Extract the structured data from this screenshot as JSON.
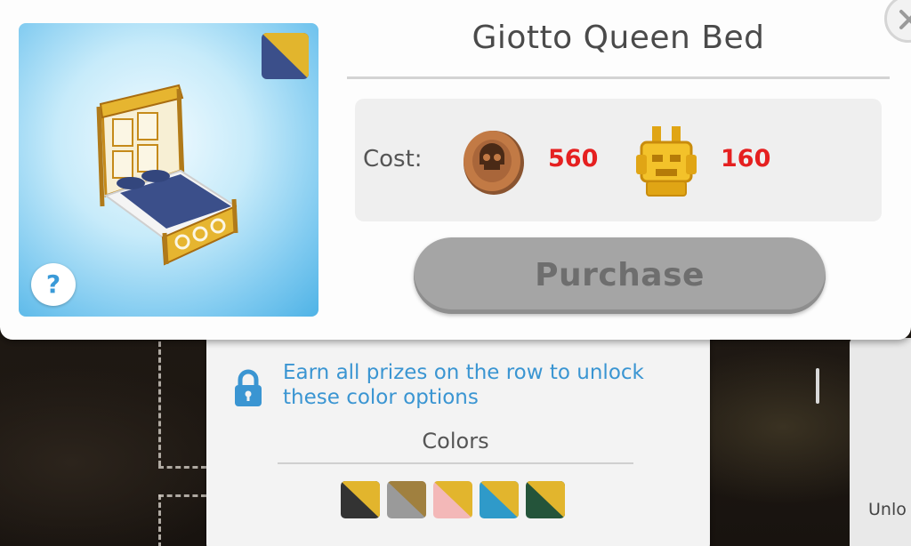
{
  "item": {
    "title": "Giotto Queen Bed"
  },
  "cost": {
    "label": "Cost:",
    "currencies": [
      {
        "icon": "skull-coin-icon",
        "amount": "560"
      },
      {
        "icon": "gold-mask-icon",
        "amount": "160"
      }
    ]
  },
  "purchase": {
    "label": "Purchase",
    "enabled": false
  },
  "help": {
    "label": "?"
  },
  "colors_panel": {
    "unlock_message": "Earn all prizes on the row to unlock these color options",
    "title": "Colors",
    "swatches": [
      {
        "name": "black-gold",
        "primary": "#333333",
        "secondary": "#e2b52d"
      },
      {
        "name": "gray-gold",
        "primary": "#9a9a9a",
        "secondary": "#a0803f"
      },
      {
        "name": "pink-gold",
        "primary": "#f3b8b8",
        "secondary": "#e2b52d"
      },
      {
        "name": "blue-gold",
        "primary": "#2f9ac9",
        "secondary": "#e2b52d"
      },
      {
        "name": "green-gold",
        "primary": "#24543a",
        "secondary": "#e2b52d"
      }
    ],
    "selected_variant": {
      "primary": "#3b4f8a",
      "secondary": "#e2b52d"
    }
  },
  "background": {
    "side_panel_text": "Unlo"
  },
  "colors": {
    "accent_blue": "#3a95d2",
    "cost_red": "#e52020",
    "disabled_button": "#a5a5a5"
  }
}
